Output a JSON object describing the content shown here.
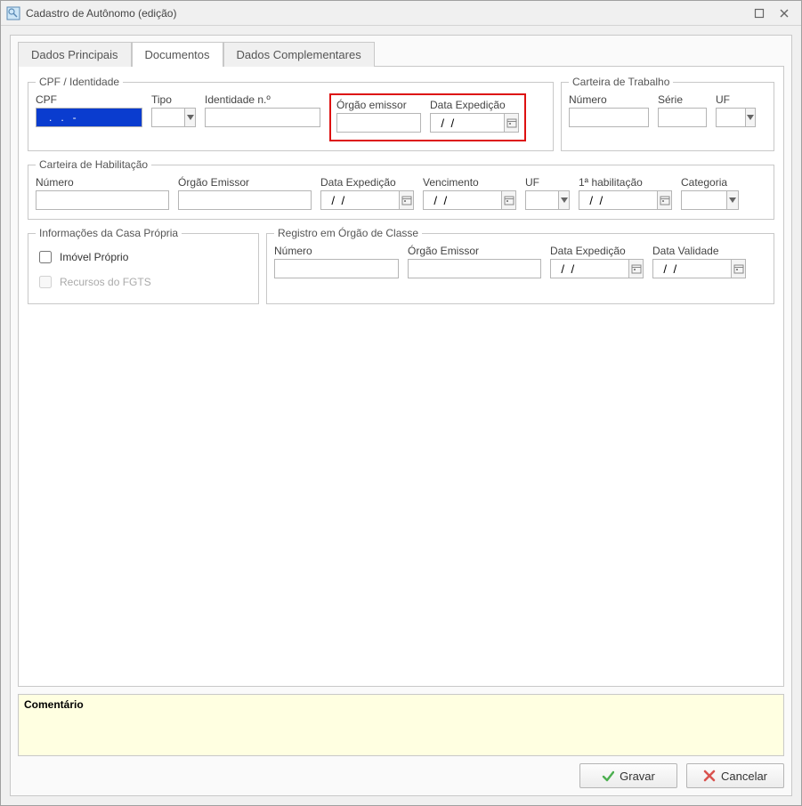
{
  "window": {
    "title": "Cadastro de Autônomo (edição)"
  },
  "tabs": {
    "dados_principais": "Dados Principais",
    "documentos": "Documentos",
    "dados_complementares": "Dados Complementares"
  },
  "cpf_identidade": {
    "legend": "CPF / Identidade",
    "cpf_label": "CPF",
    "cpf_value": "   .   .   -  ",
    "tipo_label": "Tipo",
    "tipo_value": "",
    "identidade_label": "Identidade n.º",
    "identidade_value": "",
    "orgao_label": "Órgão emissor",
    "orgao_value": "",
    "data_exp_label": "Data Expedição",
    "data_exp_value": "  /  /"
  },
  "carteira_trabalho": {
    "legend": "Carteira de Trabalho",
    "numero_label": "Número",
    "numero_value": "",
    "serie_label": "Série",
    "serie_value": "",
    "uf_label": "UF",
    "uf_value": ""
  },
  "carteira_habilitacao": {
    "legend": "Carteira de Habilitação",
    "numero_label": "Número",
    "numero_value": "",
    "orgao_label": "Órgão Emissor",
    "orgao_value": "",
    "data_exp_label": "Data Expedição",
    "data_exp_value": "  /  /",
    "vencimento_label": "Vencimento",
    "vencimento_value": "  /  /",
    "uf_label": "UF",
    "uf_value": "",
    "primeira_hab_label": "1ª habilitação",
    "primeira_hab_value": "  /  /",
    "categoria_label": "Categoria",
    "categoria_value": ""
  },
  "casa_propria": {
    "legend": "Informações da Casa Própria",
    "imovel_proprio_label": "Imóvel Próprio",
    "recursos_fgts_label": "Recursos do FGTS"
  },
  "registro_classe": {
    "legend": "Registro em Órgão de Classe",
    "numero_label": "Número",
    "numero_value": "",
    "orgao_label": "Órgão Emissor",
    "orgao_value": "",
    "data_exp_label": "Data Expedição",
    "data_exp_value": "  /  /",
    "data_val_label": "Data Validade",
    "data_val_value": "  /  /"
  },
  "comment": {
    "title": "Comentário"
  },
  "buttons": {
    "gravar": "Gravar",
    "cancelar": "Cancelar"
  }
}
